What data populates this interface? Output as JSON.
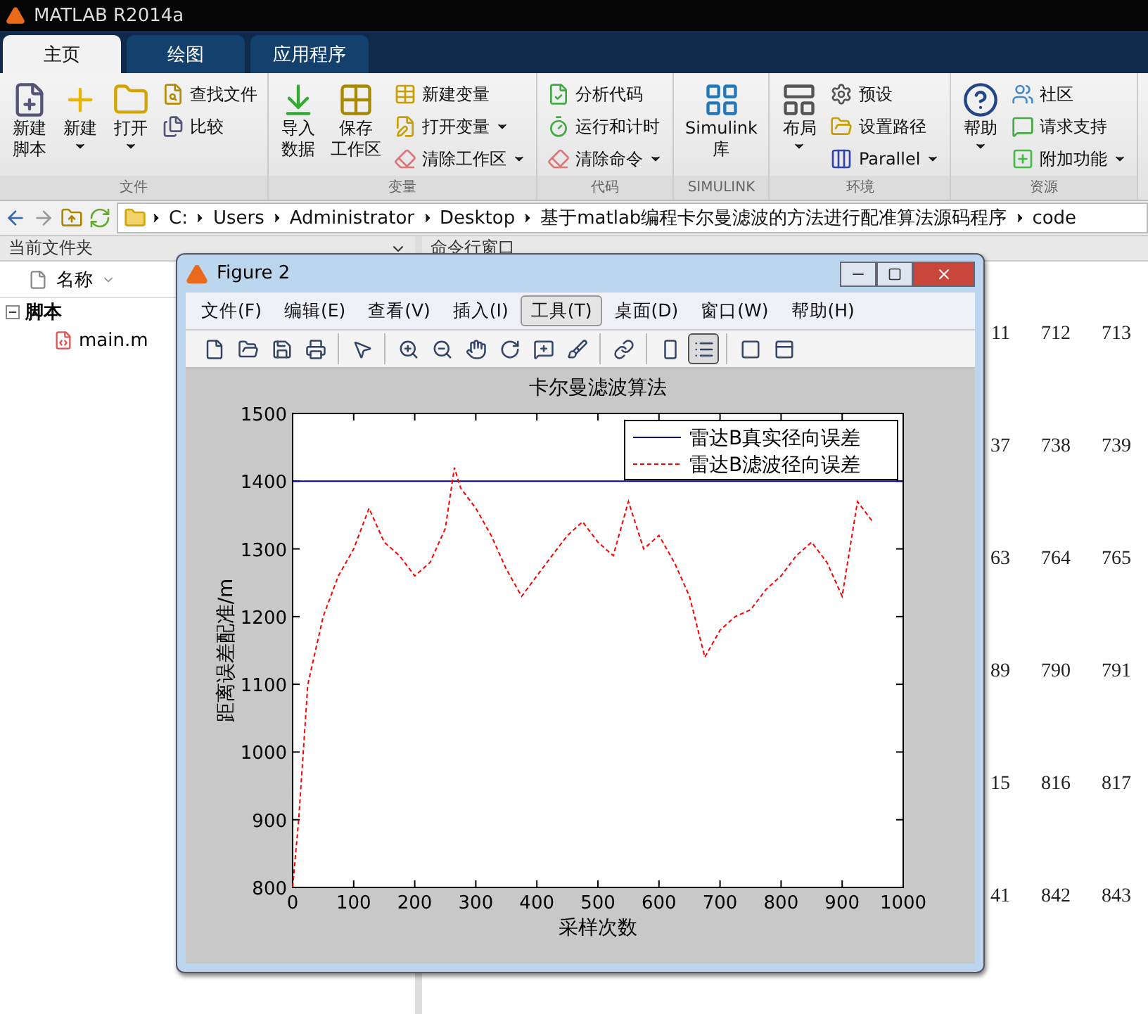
{
  "window": {
    "title": "MATLAB R2014a"
  },
  "tabs": [
    {
      "label": "主页",
      "selected": true
    },
    {
      "label": "绘图",
      "selected": false
    },
    {
      "label": "应用程序",
      "selected": false
    }
  ],
  "ribbon": {
    "groups": [
      {
        "label": "文件",
        "items": [
          {
            "kind": "large",
            "lines": [
              "新建",
              "脚本"
            ],
            "dropdown": false
          },
          {
            "kind": "large",
            "lines": [
              "新建"
            ],
            "dropdown": true
          },
          {
            "kind": "large",
            "lines": [
              "打开"
            ],
            "dropdown": true
          },
          {
            "kind": "small",
            "label": "查找文件",
            "dropdown": false
          },
          {
            "kind": "small",
            "label": "比较",
            "dropdown": false
          }
        ]
      },
      {
        "label": "变量",
        "items": [
          {
            "kind": "large",
            "lines": [
              "导入",
              "数据"
            ],
            "dropdown": false
          },
          {
            "kind": "large",
            "lines": [
              "保存",
              "工作区"
            ],
            "dropdown": false
          },
          {
            "kind": "small",
            "label": "新建变量",
            "dropdown": false
          },
          {
            "kind": "small",
            "label": "打开变量",
            "dropdown": true
          },
          {
            "kind": "small",
            "label": "清除工作区",
            "dropdown": true
          }
        ]
      },
      {
        "label": "代码",
        "items": [
          {
            "kind": "small",
            "label": "分析代码",
            "dropdown": false
          },
          {
            "kind": "small",
            "label": "运行和计时",
            "dropdown": false
          },
          {
            "kind": "small",
            "label": "清除命令",
            "dropdown": true
          }
        ]
      },
      {
        "label": "SIMULINK",
        "items": [
          {
            "kind": "large",
            "lines": [
              "Simulink",
              "库"
            ],
            "dropdown": false
          }
        ]
      },
      {
        "label": "环境",
        "items": [
          {
            "kind": "large",
            "lines": [
              "布局"
            ],
            "dropdown": true
          },
          {
            "kind": "small",
            "label": "预设",
            "dropdown": false
          },
          {
            "kind": "small",
            "label": "设置路径",
            "dropdown": false
          },
          {
            "kind": "small",
            "label": "Parallel",
            "dropdown": true
          }
        ]
      },
      {
        "label": "资源",
        "items": [
          {
            "kind": "large",
            "lines": [
              "帮助"
            ],
            "dropdown": true
          },
          {
            "kind": "small",
            "label": "社区",
            "dropdown": false
          },
          {
            "kind": "small",
            "label": "请求支持",
            "dropdown": false
          },
          {
            "kind": "small",
            "label": "附加功能",
            "dropdown": true
          }
        ]
      }
    ]
  },
  "path": [
    "C:",
    "Users",
    "Administrator",
    "Desktop",
    "基于matlab编程卡尔曼滤波的方法进行配准算法源码程序",
    "code"
  ],
  "current_folder": {
    "title": "当前文件夹",
    "column": "名称",
    "tree": [
      {
        "label": "脚本",
        "expanded": true,
        "children": [
          {
            "label": "main.m"
          }
        ]
      }
    ]
  },
  "command_window": {
    "title": "命令行窗口",
    "rows": [
      [
        "11",
        "712",
        "713"
      ],
      [
        "37",
        "738",
        "739"
      ],
      [
        "63",
        "764",
        "765"
      ],
      [
        "89",
        "790",
        "791"
      ],
      [
        "15",
        "816",
        "817"
      ],
      [
        "41",
        "842",
        "843"
      ]
    ]
  },
  "figure": {
    "title": "Figure 2",
    "menu": [
      {
        "label": "文件(F)",
        "selected": false
      },
      {
        "label": "编辑(E)",
        "selected": false
      },
      {
        "label": "查看(V)",
        "selected": false
      },
      {
        "label": "插入(I)",
        "selected": false
      },
      {
        "label": "工具(T)",
        "selected": true
      },
      {
        "label": "桌面(D)",
        "selected": false
      },
      {
        "label": "窗口(W)",
        "selected": false
      },
      {
        "label": "帮助(H)",
        "selected": false
      }
    ],
    "toolbar": [
      [
        {
          "pressed": false
        },
        {
          "pressed": false
        },
        {
          "pressed": false
        },
        {
          "pressed": false
        }
      ],
      [
        {
          "pressed": false
        }
      ],
      [
        {
          "pressed": false
        },
        {
          "pressed": false
        },
        {
          "pressed": false
        },
        {
          "pressed": false
        },
        {
          "pressed": false
        },
        {
          "pressed": false
        }
      ],
      [
        {
          "pressed": false
        }
      ],
      [
        {
          "pressed": false
        },
        {
          "pressed": true
        }
      ],
      [
        {
          "pressed": false
        },
        {
          "pressed": false
        }
      ]
    ],
    "chart_data": {
      "type": "line",
      "title": "卡尔曼滤波算法",
      "xlabel": "采样次数",
      "ylabel": "距离误差配准/m",
      "legend": true,
      "xlim": [
        0,
        1000
      ],
      "ylim": [
        800,
        1500
      ],
      "xticks": [
        0,
        100,
        200,
        300,
        400,
        500,
        600,
        700,
        800,
        900,
        1000
      ],
      "yticks": [
        800,
        900,
        1000,
        1100,
        1200,
        1300,
        1400,
        1500
      ],
      "x": [
        0,
        10,
        25,
        50,
        75,
        100,
        125,
        150,
        175,
        200,
        225,
        250,
        265,
        275,
        300,
        325,
        350,
        375,
        400,
        425,
        450,
        475,
        500,
        525,
        550,
        575,
        600,
        625,
        650,
        675,
        700,
        725,
        750,
        775,
        800,
        825,
        850,
        875,
        900,
        925,
        950
      ],
      "series": [
        {
          "name": "雷达B真实径向误差",
          "color": "#00008b",
          "line_style": "solid",
          "x": [
            0,
            1000
          ],
          "values": [
            1400,
            1400
          ]
        },
        {
          "name": "雷达B滤波径向误差",
          "color": "#ff0000",
          "line_style": "dashed",
          "values": [
            800,
            900,
            1100,
            1200,
            1260,
            1300,
            1360,
            1310,
            1290,
            1260,
            1280,
            1330,
            1420,
            1390,
            1360,
            1320,
            1270,
            1230,
            1260,
            1290,
            1320,
            1340,
            1310,
            1290,
            1370,
            1300,
            1320,
            1280,
            1230,
            1140,
            1180,
            1200,
            1210,
            1240,
            1260,
            1290,
            1310,
            1280,
            1230,
            1370,
            1340
          ]
        }
      ]
    }
  }
}
